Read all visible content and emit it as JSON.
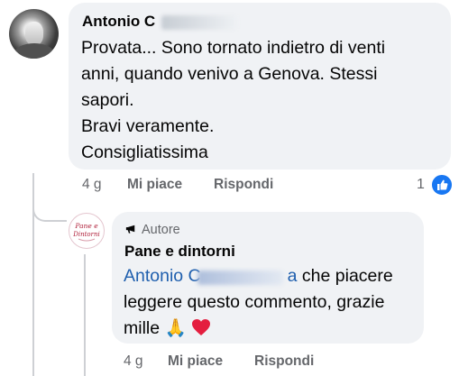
{
  "comment": {
    "author_visible": "Antonio C",
    "text": "Provata... Sono tornato indietro di venti\nanni, quando venivo a Genova. Stessi\nsapori.\nBravi veramente.\nConsigliatissima",
    "time": "4 g",
    "like_label": "Mi piace",
    "reply_label": "Rispondi",
    "reaction_count": "1",
    "reaction_icon": "thumbs-up-icon",
    "reaction_color": "#1877f2"
  },
  "reply": {
    "badge_label": "Autore",
    "author": "Pane e dintorni",
    "mention_visible": "Antonio C",
    "mention_tail": "a",
    "text_first": " che piacere",
    "text_rest": "leggere questo commento, grazie\nmille",
    "emojis": [
      "🙏",
      "❤️"
    ],
    "logo_text": "Pane e Dintorni",
    "time": "4 g",
    "like_label": "Mi piace",
    "reply_label": "Rispondi"
  },
  "colors": {
    "bubble": "#f0f2f5",
    "meta_text": "#65676b",
    "mention": "#1f5fae"
  }
}
